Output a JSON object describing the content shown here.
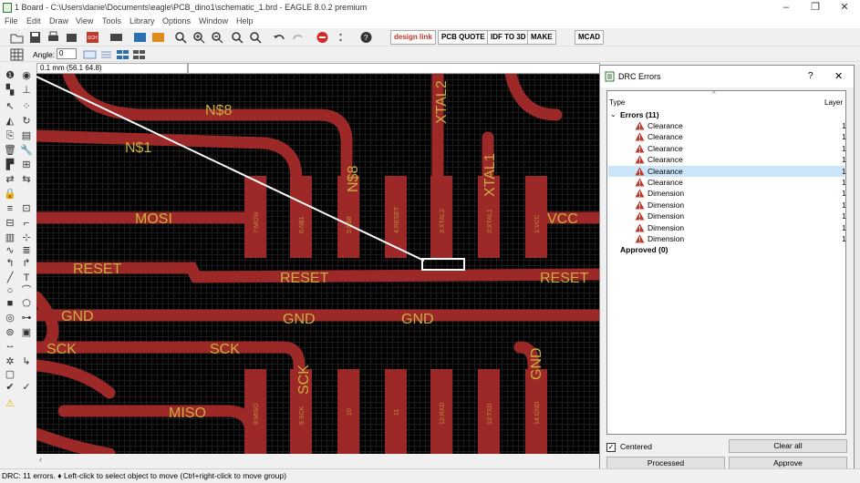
{
  "window": {
    "title": "1 Board - C:\\Users\\danie\\Documents\\eagle\\PCB_dino1\\schematic_1.brd - EAGLE 8.0.2 premium",
    "minimize": "–",
    "maximize": "❐",
    "close": "✕"
  },
  "menu": [
    "File",
    "Edit",
    "Draw",
    "View",
    "Tools",
    "Library",
    "Options",
    "Window",
    "Help"
  ],
  "toolbar": {
    "design_link": "design link",
    "pcb_quote": "PCB QUOTE",
    "idf_to_3d": "IDF TO 3D",
    "make": "MAKE",
    "mcad": "MCAD"
  },
  "toolbar2": {
    "angle_label": "Angle:",
    "angle_value": "0"
  },
  "coordinates": "0.1 mm (56.1 64.8)",
  "board": {
    "net_labels": [
      "N$8",
      "N$1",
      "MOSI",
      "RESET",
      "RESET",
      "RESET",
      "GND",
      "GND",
      "GND",
      "SCK",
      "SCK",
      "SCK",
      "MISO",
      "N$8",
      "XTAL2",
      "XTAL1",
      "VCC",
      "GND"
    ],
    "top_pads": [
      "7:MOSI",
      "6:N$1",
      "5:N$8",
      "4:RESET",
      "3:XTAL2",
      "2:XTAL1",
      "1:VCC"
    ],
    "bottom_pads": [
      "8:MISO",
      "9:SCK",
      "10",
      "11",
      "12:RXD",
      "13:TXD",
      "14:GND"
    ]
  },
  "dialog": {
    "title": "DRC Errors",
    "help": "?",
    "close": "✕",
    "col_type": "Type",
    "col_layer": "Layer",
    "group_errors": "Errors (11)",
    "errors": [
      {
        "type": "Clearance",
        "layer": "1"
      },
      {
        "type": "Clearance",
        "layer": "1"
      },
      {
        "type": "Clearance",
        "layer": "1"
      },
      {
        "type": "Clearance",
        "layer": "1"
      },
      {
        "type": "Clearance",
        "layer": "1"
      },
      {
        "type": "Clearance",
        "layer": "1"
      },
      {
        "type": "Dimension",
        "layer": "1"
      },
      {
        "type": "Dimension",
        "layer": "1"
      },
      {
        "type": "Dimension",
        "layer": "1"
      },
      {
        "type": "Dimension",
        "layer": "1"
      },
      {
        "type": "Dimension",
        "layer": "1"
      }
    ],
    "selected_index": 4,
    "group_approved": "Approved (0)",
    "centered_label": "Centered",
    "centered_checked": true,
    "clear_all": "Clear all",
    "processed": "Processed",
    "approve": "Approve"
  },
  "status": "DRC: 11 errors.  ♦ Left-click to select object to move (Ctrl+right-click to move group)",
  "colors": {
    "trace": "#9c2828",
    "text": "#c8b040",
    "canvas": "#000000",
    "highlight": "#cce4f7",
    "warning": "#c0392b"
  }
}
